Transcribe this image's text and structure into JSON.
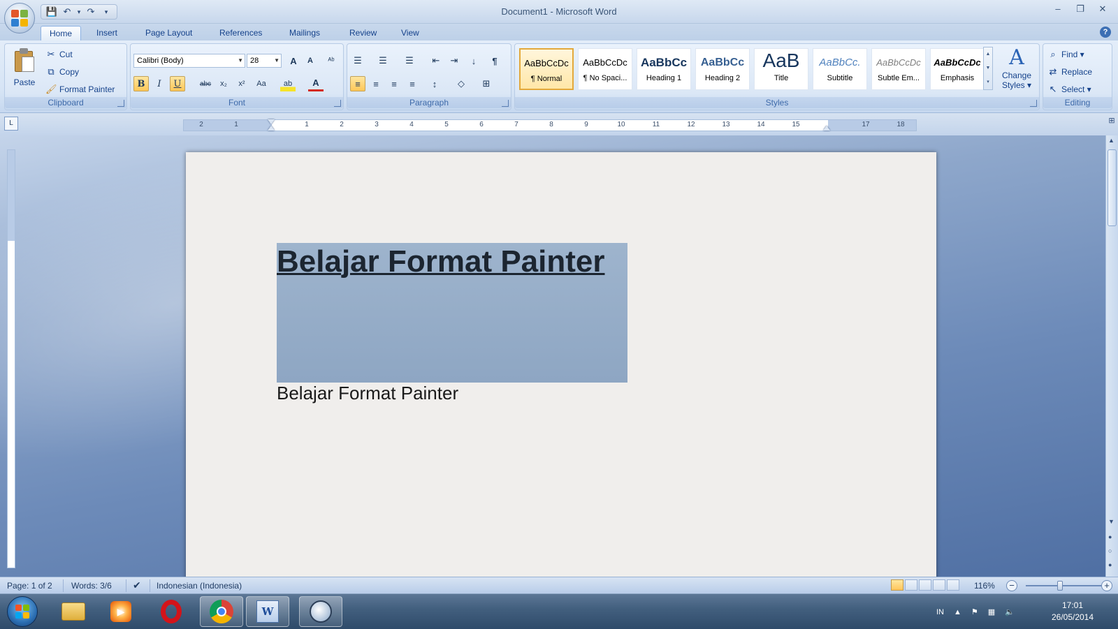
{
  "window": {
    "title": "Document1 - Microsoft Word",
    "minimize": "–",
    "restore": "❐",
    "close": "✕"
  },
  "quick_access": {
    "save": "💾",
    "undo": "↶",
    "undo_arrow": "▾",
    "redo": "↷",
    "customize": "▾"
  },
  "tabs": [
    "Home",
    "Insert",
    "Page Layout",
    "References",
    "Mailings",
    "Review",
    "View"
  ],
  "clipboard": {
    "paste": "Paste",
    "cut": "Cut",
    "copy": "Copy",
    "format_painter": "Format Painter",
    "label": "Clipboard"
  },
  "font": {
    "name": "Calibri (Body)",
    "size": "28",
    "label": "Font",
    "grow": "A",
    "shrink": "A",
    "clear": "ᴬᵇ",
    "bold": "B",
    "italic": "I",
    "underline": "U",
    "strike": "abc",
    "subscript": "x₂",
    "superscript": "x²",
    "case": "Aa",
    "highlight": "ab",
    "color": "A"
  },
  "paragraph": {
    "label": "Paragraph",
    "bullets": "☰",
    "numbering": "☰",
    "multilevel": "☰",
    "dec_indent": "⇤",
    "inc_indent": "⇥",
    "sort": "↓",
    "show_marks": "¶",
    "align_left": "≡",
    "align_center": "≡",
    "align_right": "≡",
    "justify": "≡",
    "line_spacing": "↕",
    "shading": "◇",
    "borders": "⊞"
  },
  "styles": {
    "label": "Styles",
    "items": [
      {
        "preview": "AaBbCcDc",
        "name": "¶ Normal"
      },
      {
        "preview": "AaBbCcDc",
        "name": "¶ No Spaci..."
      },
      {
        "preview": "AaBbCc",
        "name": "Heading 1"
      },
      {
        "preview": "AaBbCc",
        "name": "Heading 2"
      },
      {
        "preview": "AaB",
        "name": "Title"
      },
      {
        "preview": "AaBbCc.",
        "name": "Subtitle"
      },
      {
        "preview": "AaBbCcDc",
        "name": "Subtle Em..."
      },
      {
        "preview": "AaBbCcDc",
        "name": "Emphasis"
      }
    ],
    "scroll_up": "▲",
    "scroll_down": "▼",
    "more": "▾",
    "change_styles_line1": "Change",
    "change_styles_line2": "Styles ▾",
    "change_styles_icon": "A"
  },
  "editing": {
    "label": "Editing",
    "find": "Find ▾",
    "replace": "Replace",
    "select": "Select ▾"
  },
  "ruler": {
    "corner": "L",
    "numbers": [
      "2",
      "1",
      "1",
      "2",
      "3",
      "4",
      "5",
      "6",
      "7",
      "8",
      "9",
      "10",
      "11",
      "12",
      "13",
      "14",
      "15",
      "17",
      "18"
    ]
  },
  "document": {
    "heading": "Belajar Format Painter",
    "body": "Belajar Format Painter"
  },
  "status": {
    "page": "Page: 1 of 2",
    "words": "Words: 3/6",
    "language": "Indonesian (Indonesia)",
    "zoom": "116%",
    "zoom_out": "−",
    "zoom_in": "+"
  },
  "taskbar": {
    "lang": "IN",
    "time": "17:01",
    "date": "26/05/2014"
  },
  "colors": {
    "accent": "#15428b",
    "selection": "#9eb4cd",
    "style_selected": "#e3a93b"
  }
}
